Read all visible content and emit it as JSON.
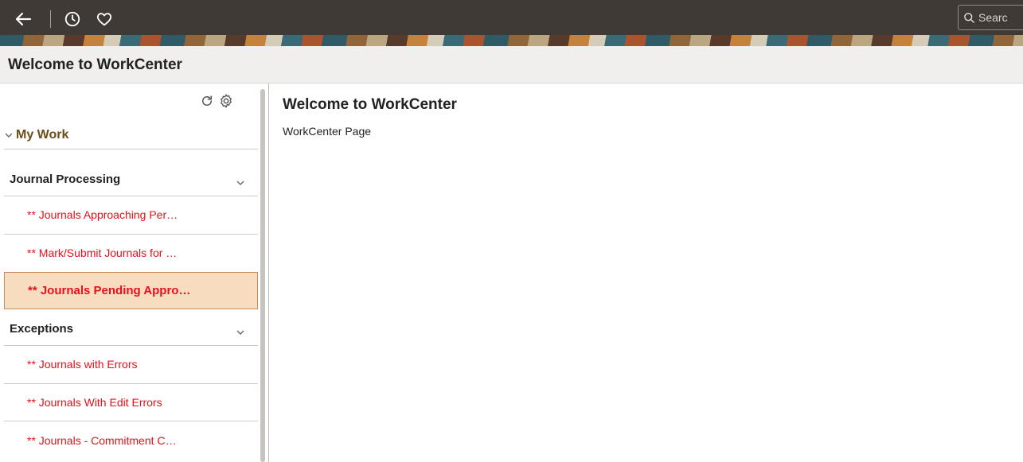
{
  "header": {
    "search_placeholder": "Searc",
    "icons": [
      "back-arrow-icon",
      "history-icon",
      "favorites-heart-icon",
      "search-icon"
    ]
  },
  "page_title": "Welcome to WorkCenter",
  "left_panel": {
    "tools": [
      "refresh-icon",
      "settings-gear-icon"
    ],
    "section_label": "My Work",
    "groups": [
      {
        "label": "Journal Processing",
        "items": [
          {
            "label": "** Journals Approaching Per…",
            "selected": false
          },
          {
            "label": "** Mark/Submit Journals for …",
            "selected": false
          },
          {
            "label": "** Journals Pending Appro…",
            "selected": true
          }
        ]
      },
      {
        "label": "Exceptions",
        "items": [
          {
            "label": "** Journals with Errors",
            "selected": false
          },
          {
            "label": "** Journals With Edit Errors",
            "selected": false
          },
          {
            "label": "** Journals - Commitment C…",
            "selected": false
          }
        ]
      }
    ]
  },
  "main": {
    "title": "Welcome to WorkCenter",
    "subtitle": "WorkCenter Page"
  },
  "colors": {
    "header_bg": "#3f3a36",
    "link_red": "#e8101a",
    "selected_bg": "#f7dcbf",
    "selected_border": "#c98a57",
    "section_brown": "#6b4e1a"
  }
}
